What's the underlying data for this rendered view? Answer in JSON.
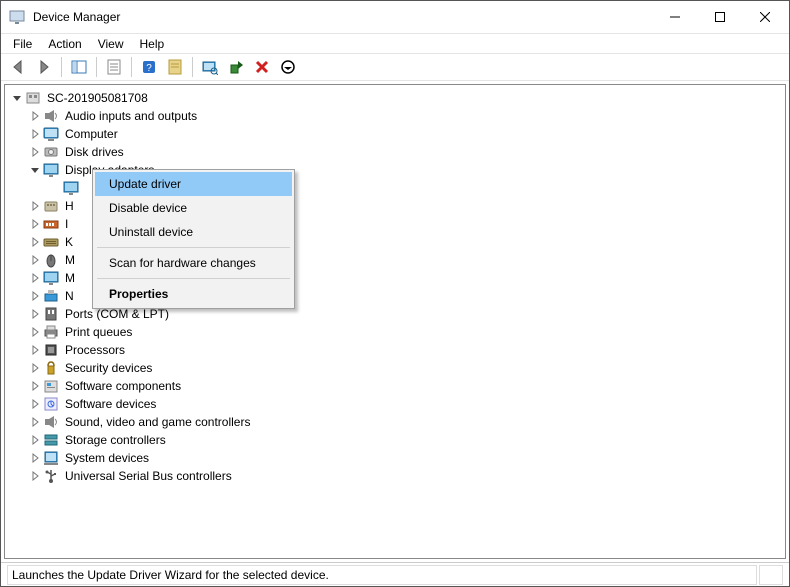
{
  "title": "Device Manager",
  "menu": {
    "file": "File",
    "action": "Action",
    "view": "View",
    "help": "Help"
  },
  "tree": {
    "root": "SC-201905081708",
    "items": [
      {
        "label": "Audio inputs and outputs",
        "icon": "audio"
      },
      {
        "label": "Computer",
        "icon": "computer"
      },
      {
        "label": "Disk drives",
        "icon": "disk"
      },
      {
        "label": "Display adapters",
        "icon": "display",
        "expanded": true
      },
      {
        "label": "H",
        "icon": "hid",
        "truncated": true
      },
      {
        "label": "I",
        "icon": "ide",
        "truncated": true
      },
      {
        "label": "K",
        "icon": "keyboard",
        "truncated": true
      },
      {
        "label": "M",
        "icon": "mouse",
        "truncated": true
      },
      {
        "label": "M",
        "icon": "display",
        "truncated": true
      },
      {
        "label": "N",
        "icon": "network",
        "truncated": true
      },
      {
        "label": "Ports (COM & LPT)",
        "icon": "ports"
      },
      {
        "label": "Print queues",
        "icon": "printer"
      },
      {
        "label": "Processors",
        "icon": "cpu"
      },
      {
        "label": "Security devices",
        "icon": "security"
      },
      {
        "label": "Software components",
        "icon": "swcomp"
      },
      {
        "label": "Software devices",
        "icon": "swdev"
      },
      {
        "label": "Sound, video and game controllers",
        "icon": "audio"
      },
      {
        "label": "Storage controllers",
        "icon": "storage"
      },
      {
        "label": "System devices",
        "icon": "system"
      },
      {
        "label": "Universal Serial Bus controllers",
        "icon": "usb"
      }
    ]
  },
  "context_menu": {
    "update": "Update driver",
    "disable": "Disable device",
    "uninstall": "Uninstall device",
    "scan": "Scan for hardware changes",
    "properties": "Properties"
  },
  "status": "Launches the Update Driver Wizard for the selected device."
}
